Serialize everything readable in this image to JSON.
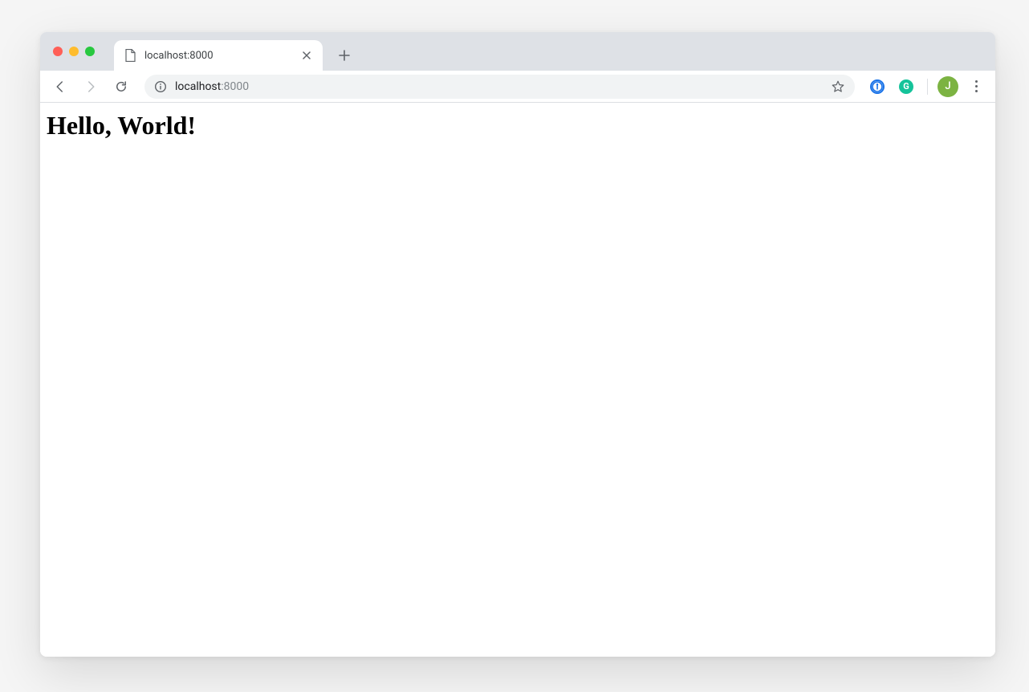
{
  "tab": {
    "title": "localhost:8000"
  },
  "addressbar": {
    "host": "localhost",
    "port": ":8000"
  },
  "profile": {
    "initial": "J"
  },
  "ext": {
    "one_password_glyph": "①",
    "grammarly_glyph": "G"
  },
  "page": {
    "heading": "Hello, World!"
  }
}
